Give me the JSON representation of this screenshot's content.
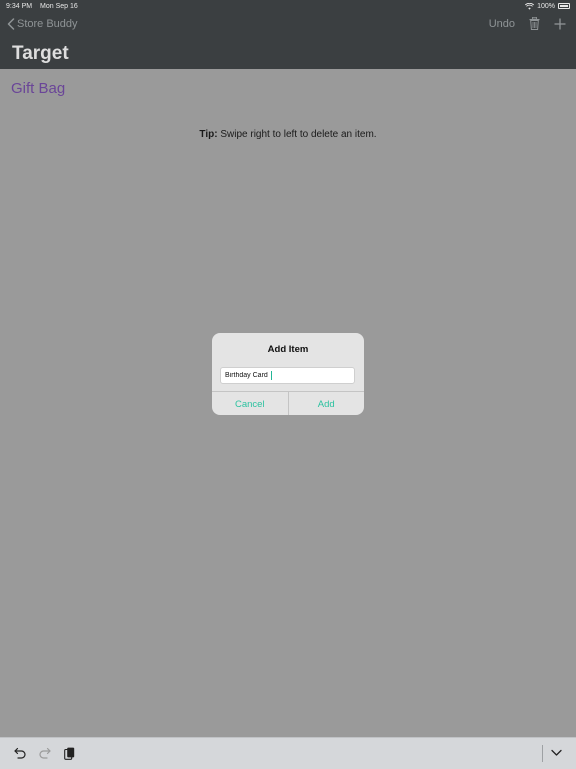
{
  "status_bar": {
    "time": "9:34 PM",
    "date": "Mon Sep 16",
    "battery": "100%",
    "wifi_icon": "wifi-icon",
    "battery_icon": "battery-icon"
  },
  "nav": {
    "back_label": "Store Buddy",
    "undo_label": "Undo",
    "title": "Target"
  },
  "content": {
    "section_title": "Gift Bag",
    "tip_label": "Tip:",
    "tip_text": " Swipe right to left to delete an item."
  },
  "dialog": {
    "title": "Add Item",
    "input_value": "Birthday Card",
    "cancel_label": "Cancel",
    "add_label": "Add"
  },
  "colors": {
    "nav_background": "#3b3f41",
    "page_background": "#9a9a9a",
    "section_title": "#6a4598",
    "accent": "#2cc2a0"
  }
}
